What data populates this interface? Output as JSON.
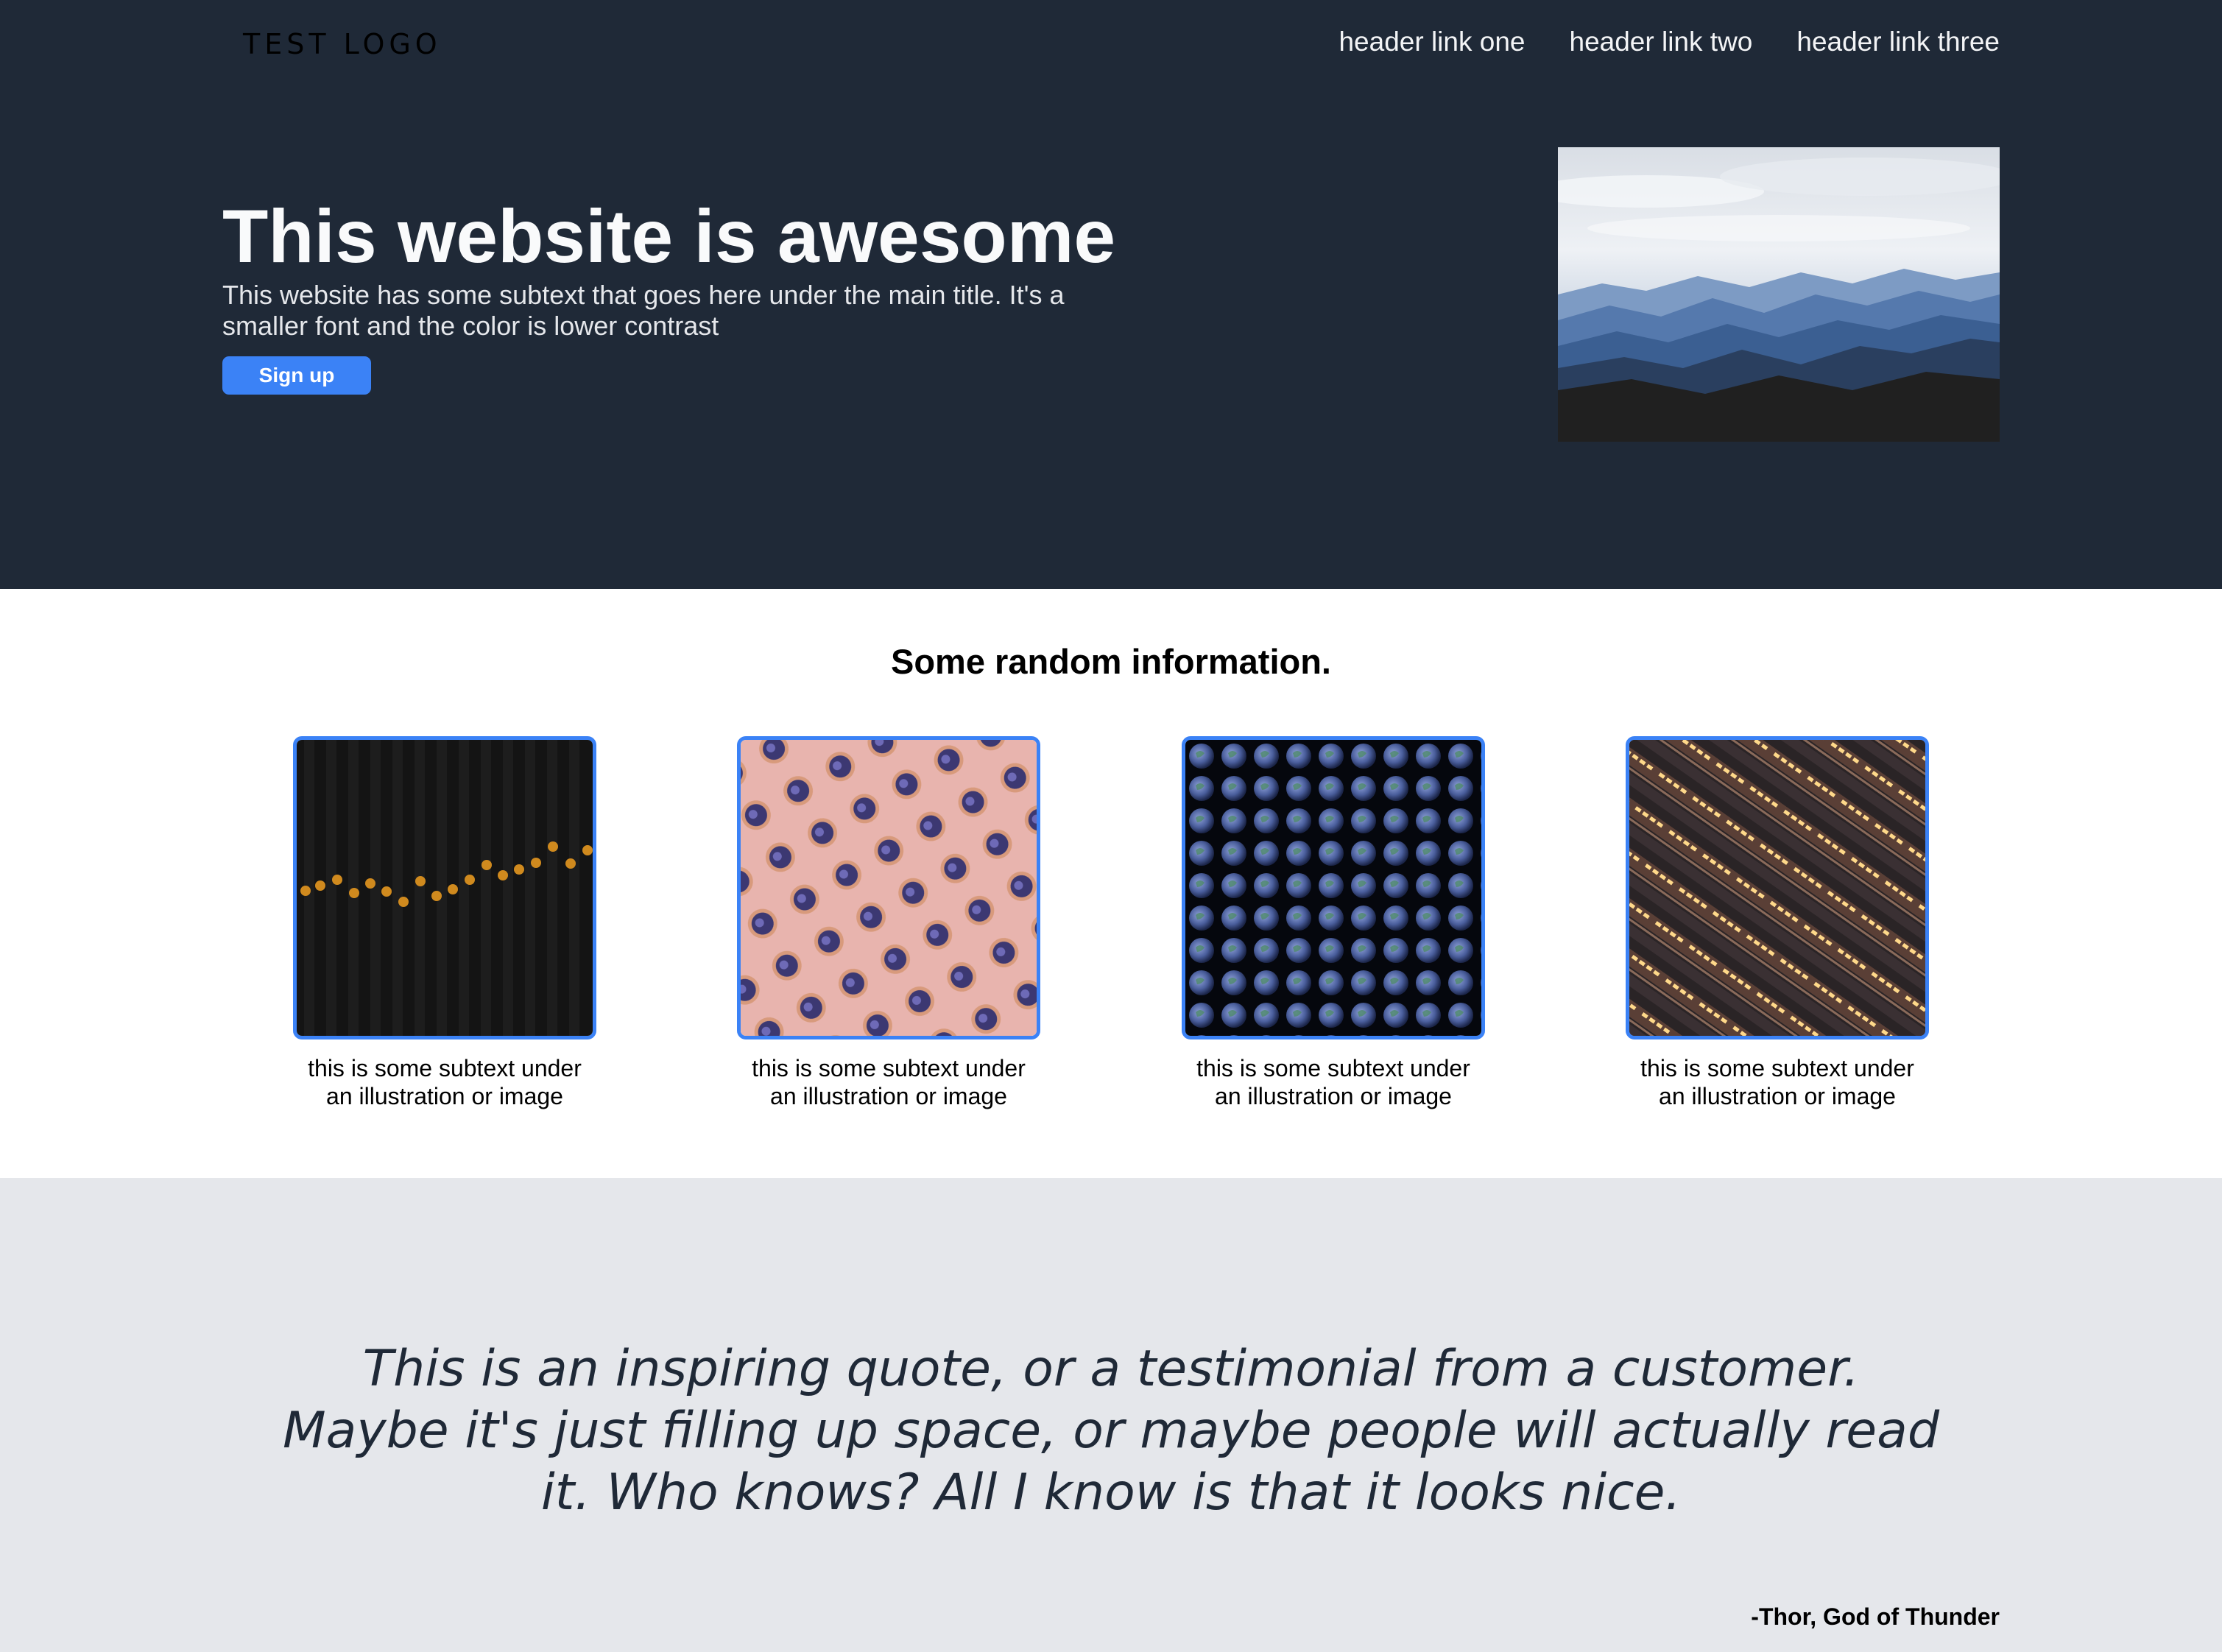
{
  "header": {
    "logo": "TEST LOGO",
    "links": [
      "header link one",
      "header link two",
      "header link three"
    ]
  },
  "hero": {
    "title": "This website is awesome",
    "subtitle": "This website has some subtext that goes here under the main title. It's a smaller font and the color is lower contrast",
    "button_label": "Sign up",
    "image": "mountain-landscape-image"
  },
  "info": {
    "title": "Some random information.",
    "cards": [
      {
        "image": "candles-on-dark-panels-image",
        "caption": "this is some subtext under an illustration or image"
      },
      {
        "image": "tins-on-pink-background-image",
        "caption": "this is some subtext under an illustration or image"
      },
      {
        "image": "earth-globes-pattern-image",
        "caption": "this is some subtext under an illustration or image"
      },
      {
        "image": "isometric-trains-image",
        "caption": "this is some subtext under an illustration or image"
      }
    ]
  },
  "quote": {
    "text": "This is an inspiring quote, or a testimonial from a customer. Maybe it's just filling up space, or maybe people will actually read it. Who knows? All I know is that it looks nice.",
    "author": "-Thor, God of Thunder"
  },
  "colors": {
    "hero_background": "#1f2937",
    "accent": "#3b82f6",
    "quote_background": "#e5e7eb"
  }
}
